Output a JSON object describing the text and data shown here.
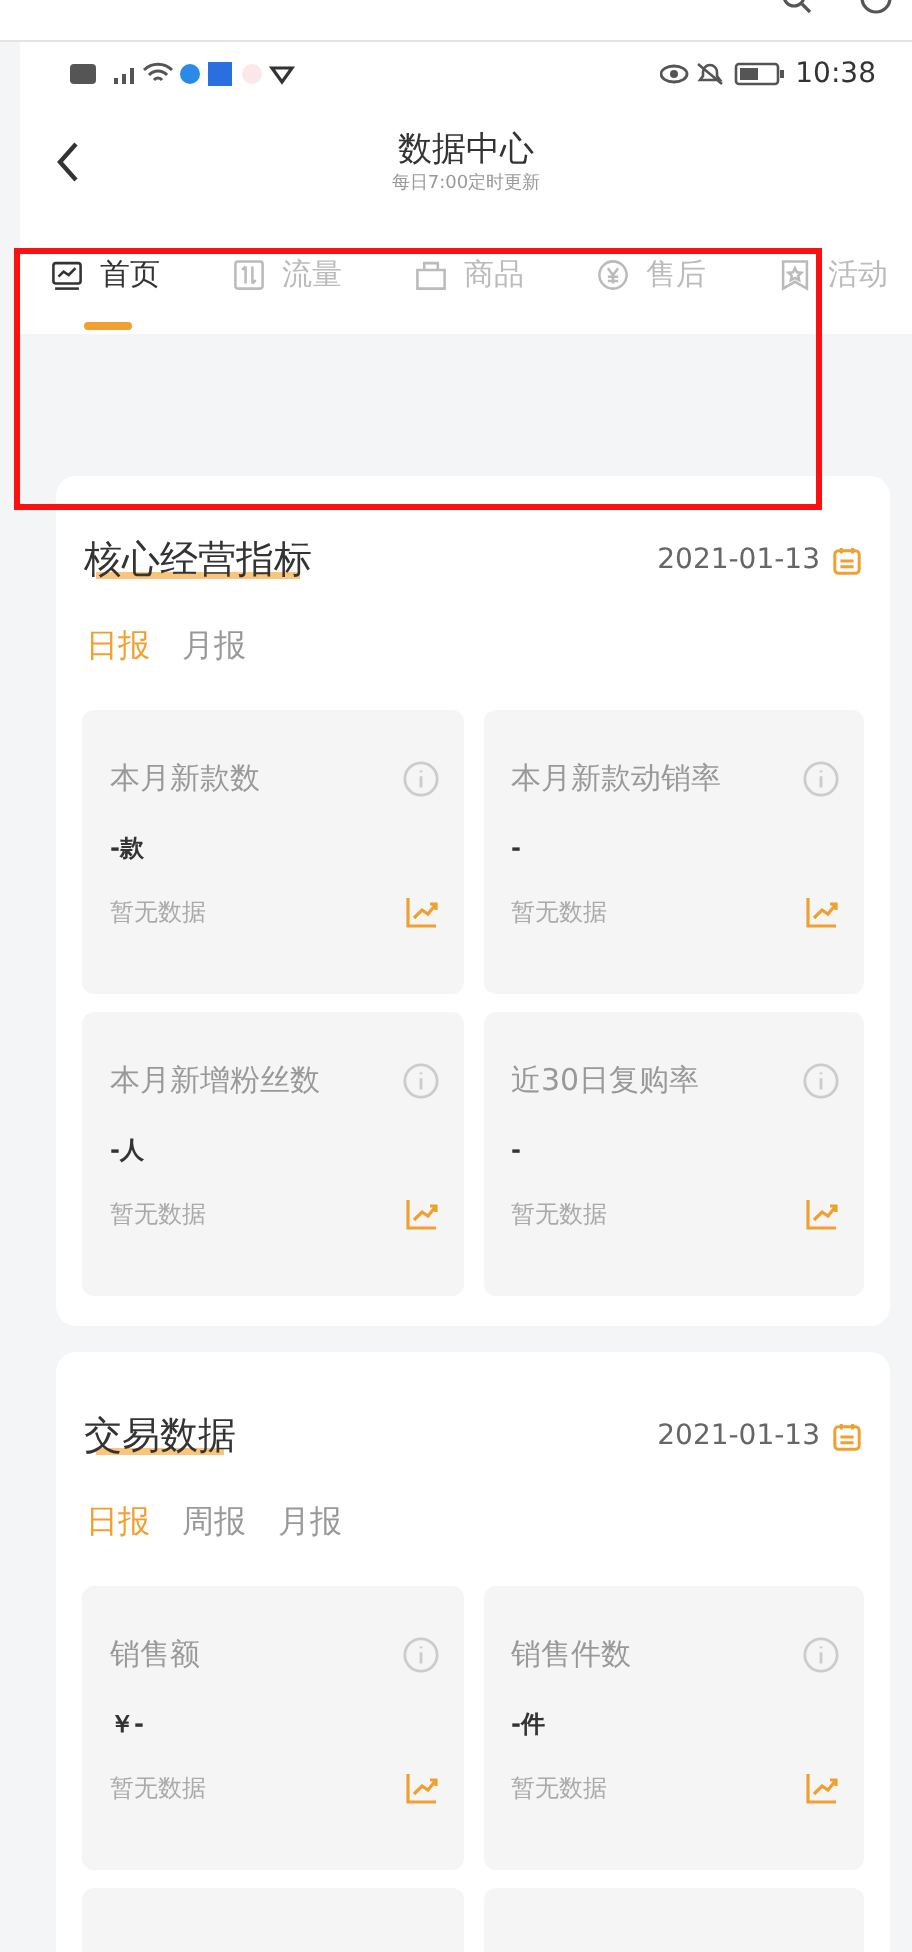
{
  "status_bar": {
    "time": "10:38"
  },
  "header": {
    "title": "数据中心",
    "subtitle": "每日7:00定时更新"
  },
  "tabs": [
    {
      "label": "首页",
      "selected": true
    },
    {
      "label": "流量",
      "selected": false
    },
    {
      "label": "商品",
      "selected": false
    },
    {
      "label": "售后",
      "selected": false
    },
    {
      "label": "活动",
      "selected": false
    }
  ],
  "annotation": {
    "kind": "rectangle"
  },
  "sections": [
    {
      "title": "核心经营指标",
      "date": "2021-01-13",
      "periods": [
        {
          "label": "日报",
          "selected": true
        },
        {
          "label": "月报",
          "selected": false
        }
      ],
      "tiles": [
        {
          "kind": "metric",
          "label": "本月新款数",
          "value": "-款",
          "note": "暂无数据"
        },
        {
          "kind": "metric",
          "label": "本月新款动销率",
          "value": "-",
          "note": "暂无数据"
        },
        {
          "kind": "metric",
          "label": "本月新增粉丝数",
          "value": "-人",
          "note": "暂无数据"
        },
        {
          "kind": "metric",
          "label": "近30日复购率",
          "value": "-",
          "note": "暂无数据"
        }
      ]
    },
    {
      "title": "交易数据",
      "date": "2021-01-13",
      "periods": [
        {
          "label": "日报",
          "selected": true
        },
        {
          "label": "周报",
          "selected": false
        },
        {
          "label": "月报",
          "selected": false
        }
      ],
      "tiles": [
        {
          "kind": "metric",
          "label": "销售额",
          "value": "￥-",
          "note": "暂无数据"
        },
        {
          "kind": "metric",
          "label": "销售件数",
          "value": "-件",
          "note": "暂无数据"
        },
        {
          "kind": "cut"
        },
        {
          "kind": "cut"
        }
      ]
    }
  ]
}
